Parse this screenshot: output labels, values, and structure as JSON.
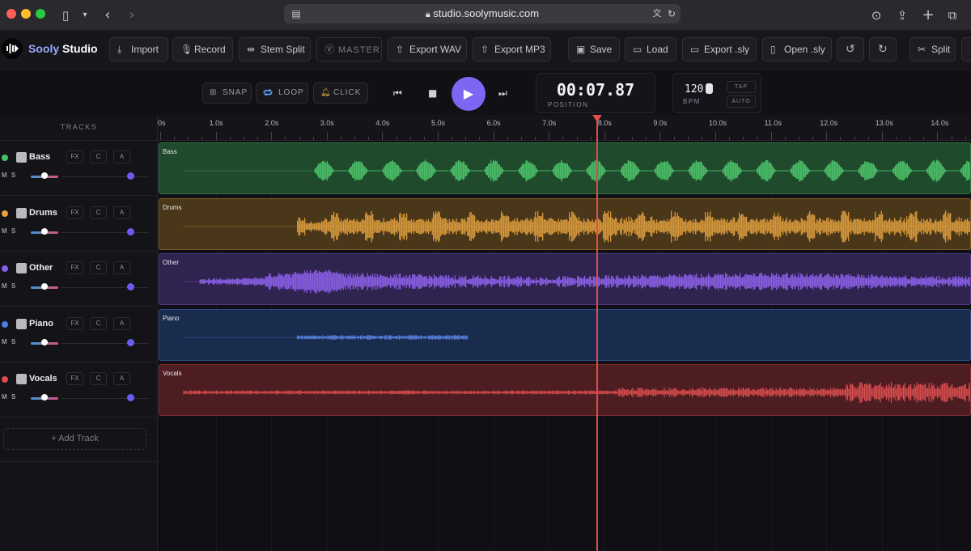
{
  "browser": {
    "url": "studio.soolymusic.com",
    "icons": [
      "sidebar-icon",
      "chevron-down-icon",
      "back-icon",
      "forward-icon",
      "tab-icon",
      "lock-icon",
      "translate-icon",
      "reload-icon",
      "download-icon",
      "share-icon",
      "new-tab-icon",
      "tabs-overview-icon"
    ]
  },
  "app": {
    "brand_part1": "Sooly",
    "brand_part2": " Studio"
  },
  "toolbar": {
    "buttons": [
      {
        "label": "Import",
        "icon": "import-icon"
      },
      {
        "label": "Record",
        "icon": "microphone-icon"
      },
      {
        "label": "Stem Split",
        "icon": "split-arrows-icon"
      },
      {
        "label": "MASTER",
        "icon": "master-icon"
      },
      {
        "label": "Export WAV",
        "icon": "upload-icon"
      },
      {
        "label": "Export MP3",
        "icon": "upload-icon"
      },
      {
        "label": "Save",
        "icon": "floppy-icon"
      },
      {
        "label": "Load",
        "icon": "folder-icon"
      },
      {
        "label": "Export .sly",
        "icon": "monitor-icon"
      },
      {
        "label": "Open .sly",
        "icon": "file-icon"
      },
      {
        "label": "",
        "icon": "undo-icon"
      },
      {
        "label": "",
        "icon": "redo-icon"
      },
      {
        "label": "Split",
        "icon": "scissors-icon"
      }
    ]
  },
  "transport": {
    "snap": "SNAP",
    "loop": "LOOP",
    "click": "CLICK",
    "position": "00:07.87",
    "position_label": "POSITION",
    "bpm": "120",
    "bpm_label": "BPM",
    "tap": "TAP",
    "auto": "AUTO"
  },
  "tracks_header": "TRACKS",
  "add_track": "+  Add Track",
  "track_controls": {
    "fx": "FX",
    "c": "C",
    "a": "A",
    "mute": "M",
    "solo": "S"
  },
  "tracks": [
    {
      "name": "Bass",
      "color": "#43c26a",
      "clip_bg": "#1f4a2b",
      "wave_color": "#4fc86e",
      "playhead_fraction": 0.54,
      "wave_start": 0.19,
      "wave_end": 1.0,
      "style": "pulses"
    },
    {
      "name": "Drums",
      "color": "#e8a33a",
      "clip_bg": "#4a3618",
      "wave_color": "#e0a03f",
      "wave_start": 0.17,
      "wave_end": 1.0,
      "style": "dense"
    },
    {
      "name": "Other",
      "color": "#8a5ef0",
      "clip_bg": "#2f2350",
      "wave_color": "#8f63ef",
      "wave_start": 0.05,
      "wave_end": 1.0,
      "style": "mid"
    },
    {
      "name": "Piano",
      "color": "#4a7fe8",
      "clip_bg": "#1a2c4e",
      "wave_color": "#5a86e6",
      "wave_start": 0.17,
      "wave_end": 0.38,
      "style": "thin"
    },
    {
      "name": "Vocals",
      "color": "#e44a4a",
      "clip_bg": "#4d1d22",
      "wave_color": "#d94d4d",
      "wave_start": 0.03,
      "wave_end": 1.0,
      "style": "vocals"
    }
  ],
  "ruler": {
    "labels": [
      "0s",
      "1.0s",
      "2.0s",
      "3.0s",
      "4.0s",
      "5.0s",
      "6.0s",
      "7.0s",
      "8.0s",
      "9.0s",
      "10.0s",
      "11.0s",
      "12.0s",
      "13.0s",
      "14.0s"
    ]
  },
  "playhead_seconds": 7.87
}
